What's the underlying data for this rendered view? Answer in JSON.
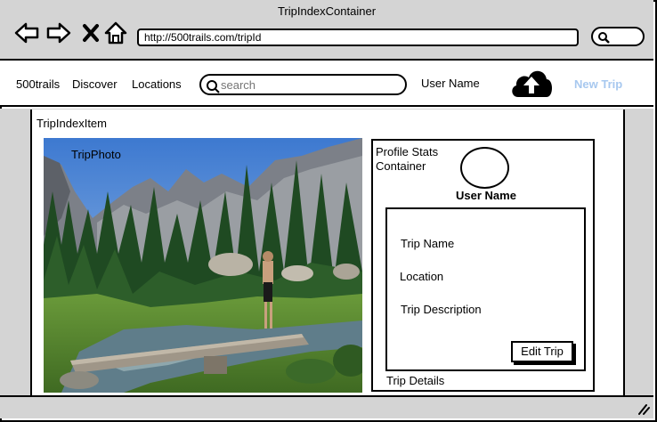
{
  "window": {
    "title": "TripIndexContainer",
    "url": "http://500trails.com/tripId"
  },
  "browser_icons": [
    "back-arrow-icon",
    "forward-arrow-icon",
    "close-icon",
    "home-icon",
    "search-icon"
  ],
  "nav": {
    "brand": "500trails",
    "discover": "Discover",
    "locations": "Locations",
    "search_placeholder": "search",
    "user_name": "User Name",
    "upload_icon": "cloud-upload-icon",
    "new_trip": "New Trip"
  },
  "trip_index": {
    "label": "TripIndexItem",
    "photo_label": "TripPhoto"
  },
  "profile": {
    "container_label": "Profile Stats Container",
    "user_name": "User Name"
  },
  "details": {
    "trip_name": "Trip Name",
    "location": "Location",
    "description": "Trip Description",
    "edit_button": "Edit Trip",
    "footer_label": "Trip Details"
  },
  "colors": {
    "chrome": "#d4d4d4",
    "new_trip_link": "#a7c8ef"
  }
}
